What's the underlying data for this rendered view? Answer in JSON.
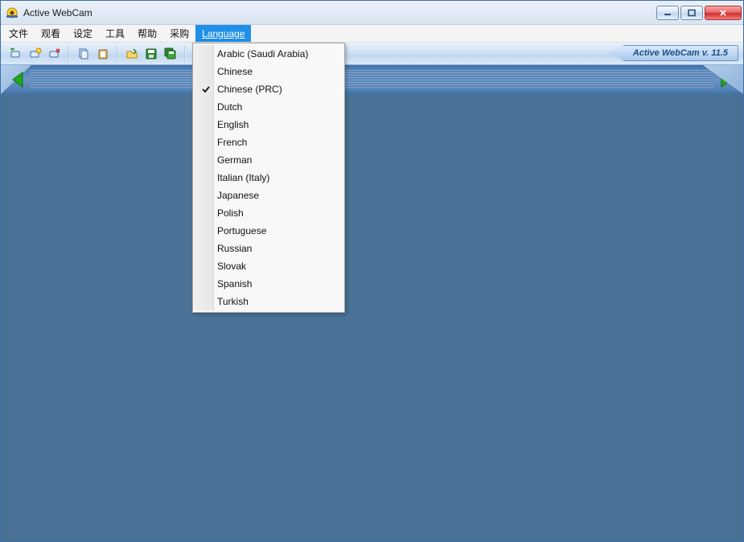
{
  "titlebar": {
    "title": "Active WebCam"
  },
  "menubar": {
    "items": [
      {
        "label": "文件"
      },
      {
        "label": "观看"
      },
      {
        "label": "设定"
      },
      {
        "label": "工具"
      },
      {
        "label": "帮助"
      },
      {
        "label": "采购"
      },
      {
        "label": "Language",
        "active": true
      }
    ]
  },
  "toolbar": {
    "version_label": "Active WebCam v. 11.5"
  },
  "language_menu": {
    "items": [
      {
        "label": "Arabic (Saudi Arabia)",
        "checked": false
      },
      {
        "label": "Chinese",
        "checked": false
      },
      {
        "label": "Chinese (PRC)",
        "checked": true
      },
      {
        "label": "Dutch",
        "checked": false
      },
      {
        "label": "English",
        "checked": false
      },
      {
        "label": "French",
        "checked": false
      },
      {
        "label": "German",
        "checked": false
      },
      {
        "label": "Italian (Italy)",
        "checked": false
      },
      {
        "label": "Japanese",
        "checked": false
      },
      {
        "label": "Polish",
        "checked": false
      },
      {
        "label": "Portuguese",
        "checked": false
      },
      {
        "label": "Russian",
        "checked": false
      },
      {
        "label": "Slovak",
        "checked": false
      },
      {
        "label": "Spanish",
        "checked": false
      },
      {
        "label": "Turkish",
        "checked": false
      }
    ]
  }
}
